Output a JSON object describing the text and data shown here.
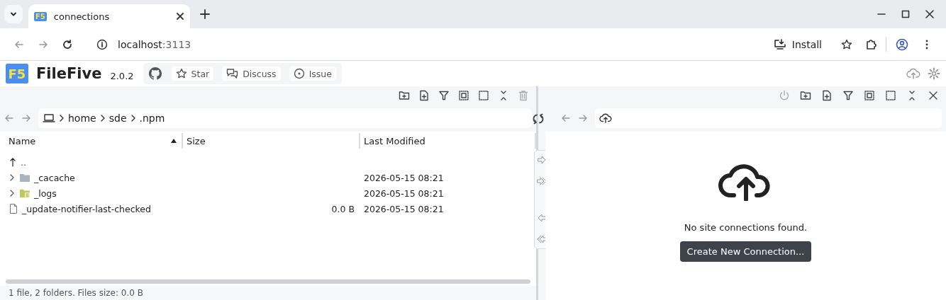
{
  "browser": {
    "tab": {
      "title": "connections",
      "favicon": "F5"
    },
    "address": {
      "host": "localhost",
      "port": ":3113"
    },
    "install_label": "Install"
  },
  "app": {
    "logo": "F5",
    "name": "FileFive",
    "version": "2.0.2",
    "links": [
      {
        "label": "Star",
        "kind": "star"
      },
      {
        "label": "Discuss",
        "kind": "discuss"
      },
      {
        "label": "Issue",
        "kind": "issue"
      }
    ]
  },
  "local": {
    "path": [
      "home",
      "sde",
      ".npm"
    ],
    "columns": [
      {
        "label": "Name",
        "sorted": true
      },
      {
        "label": "Size",
        "sorted": false
      },
      {
        "label": "Last Modified",
        "sorted": false
      }
    ],
    "rows": [
      {
        "kind": "up",
        "name": "..",
        "size": "",
        "modified": ""
      },
      {
        "kind": "folder",
        "name": "_cacache",
        "color": "#a9b4bd",
        "expanded": false,
        "size": "",
        "modified": "2026-05-15 08:21"
      },
      {
        "kind": "folder-docs",
        "name": "_logs",
        "color": "#c4c75a",
        "expanded": false,
        "size": "",
        "modified": "2026-05-15 08:21"
      },
      {
        "kind": "file",
        "name": "_update-notifier-last-checked",
        "size": "0.0 B",
        "modified": "2026-05-15 08:21"
      }
    ],
    "status": "1 file, 2 folders. Files size: 0.0 B"
  },
  "remote": {
    "message": "No site connections found.",
    "button": "Create New Connection..."
  }
}
